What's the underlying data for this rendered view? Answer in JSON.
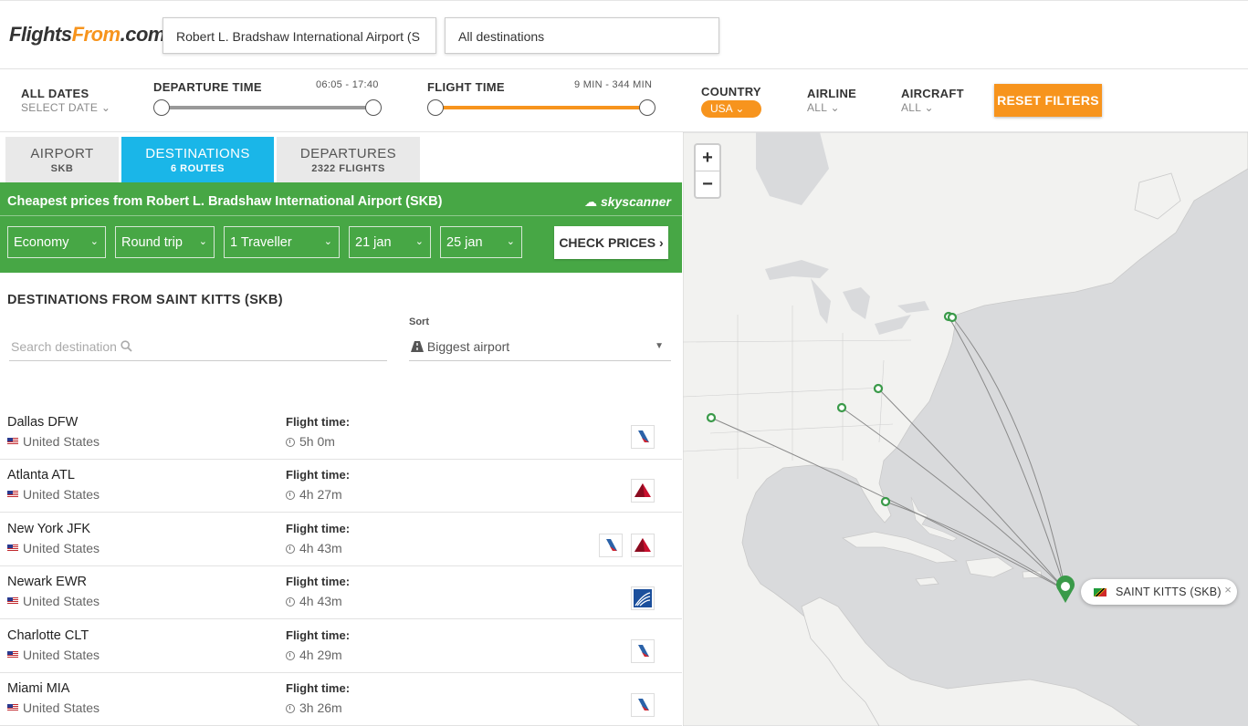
{
  "logo": {
    "part1": "Flights",
    "part2": "From",
    "part3": ".com"
  },
  "search": {
    "origin": "Robert L. Bradshaw International Airport (S",
    "destination": "All destinations"
  },
  "filters": {
    "all_dates_label": "ALL DATES",
    "all_dates_value": "SELECT DATE",
    "departure_time_label": "DEPARTURE TIME",
    "departure_time_range": "06:05 - 17:40",
    "flight_time_label": "FLIGHT TIME",
    "flight_time_range": "9 MIN - 344 MIN",
    "country_label": "COUNTRY",
    "country_value": "USA",
    "airline_label": "AIRLINE",
    "airline_value": "ALL",
    "aircraft_label": "AIRCRAFT",
    "aircraft_value": "ALL",
    "reset_label": "RESET FILTERS",
    "colors": {
      "accent": "#f7941d"
    }
  },
  "tabs": [
    {
      "label": "AIRPORT",
      "sub": "SKB",
      "active": false
    },
    {
      "label": "DESTINATIONS",
      "sub": "6 ROUTES",
      "active": true
    },
    {
      "label": "DEPARTURES",
      "sub": "2322 FLIGHTS",
      "active": false
    }
  ],
  "skyscanner": {
    "title": "Cheapest prices from Robert L. Bradshaw International Airport (SKB)",
    "brand": "skyscanner",
    "cabin": "Economy",
    "trip": "Round trip",
    "travellers": "1 Traveller",
    "depart": "21 jan",
    "return": "25 jan",
    "check_label": "CHECK PRICES",
    "color": "#47a745"
  },
  "destinations": {
    "heading": "DESTINATIONS FROM SAINT KITTS (SKB)",
    "search_placeholder": "Search destination",
    "sort_label": "Sort",
    "sort_value": "Biggest airport",
    "flight_time_label": "Flight time:",
    "rows": [
      {
        "city": "Dallas DFW",
        "country": "United States",
        "time": "5h 0m",
        "airlines": [
          "american-airlines"
        ]
      },
      {
        "city": "Atlanta ATL",
        "country": "United States",
        "time": "4h 27m",
        "airlines": [
          "delta"
        ]
      },
      {
        "city": "New York JFK",
        "country": "United States",
        "time": "4h 43m",
        "airlines": [
          "american-airlines",
          "delta"
        ]
      },
      {
        "city": "Newark EWR",
        "country": "United States",
        "time": "4h 43m",
        "airlines": [
          "united"
        ]
      },
      {
        "city": "Charlotte CLT",
        "country": "United States",
        "time": "4h 29m",
        "airlines": [
          "american-airlines"
        ]
      },
      {
        "city": "Miami MIA",
        "country": "United States",
        "time": "3h 26m",
        "airlines": [
          "american-airlines"
        ]
      }
    ]
  },
  "map": {
    "zoom_in": "+",
    "zoom_out": "−",
    "popup_label": "SAINT KITTS (SKB)",
    "close": "×",
    "marker_color": "#3a9a49"
  }
}
